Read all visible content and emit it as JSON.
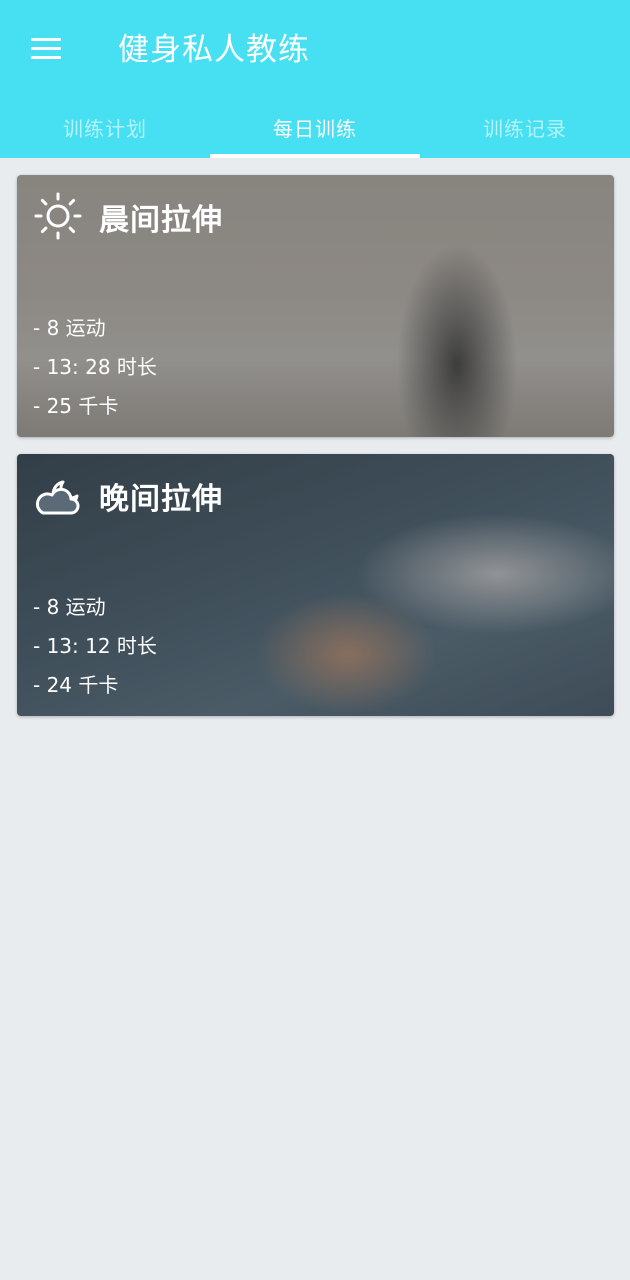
{
  "header": {
    "title": "健身私人教练",
    "menu_icon": "hamburger-menu-icon",
    "background_color": "#46e0f2"
  },
  "tabs": [
    {
      "label": "训练计划",
      "active": false
    },
    {
      "label": "每日训练",
      "active": true
    },
    {
      "label": "训练记录",
      "active": false
    }
  ],
  "workouts": [
    {
      "title": "晨间拉伸",
      "icon": "sun-icon",
      "stats": [
        "- 8 运动",
        "- 13: 28 时长",
        "- 25 千卡"
      ]
    },
    {
      "title": "晚间拉伸",
      "icon": "moon-cloud-icon",
      "stats": [
        "- 8 运动",
        "- 13: 12 时长",
        "- 24 千卡"
      ]
    }
  ]
}
